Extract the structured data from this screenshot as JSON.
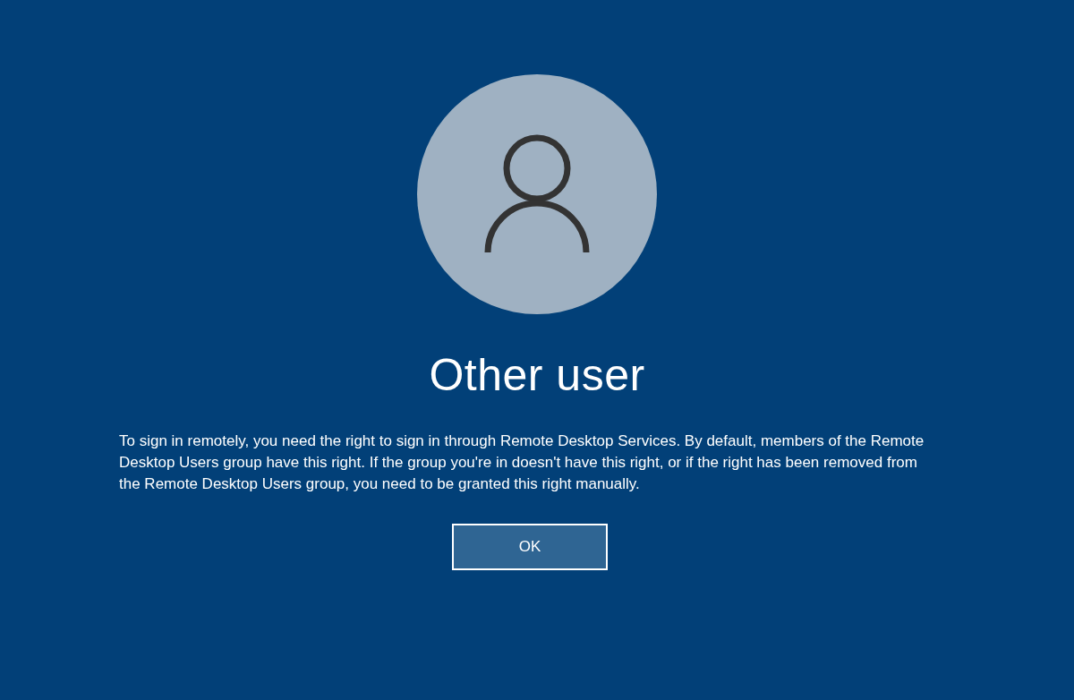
{
  "user": {
    "name": "Other user"
  },
  "message": "To sign in remotely, you need the right to sign in through Remote Desktop Services. By default, members of the Remote Desktop Users group have this right. If the group you're in doesn't have this right, or if the right has been removed from the Remote Desktop Users group, you need to be granted this right manually.",
  "buttons": [
    {
      "label": "OK"
    }
  ]
}
